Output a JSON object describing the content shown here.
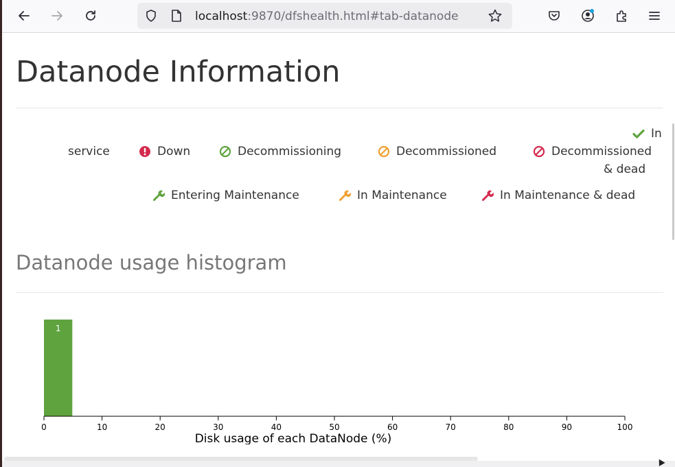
{
  "browser": {
    "url_host": "localhost",
    "url_rest": ":9870/dfshealth.html#tab-datanode"
  },
  "page": {
    "title": "Datanode Information",
    "histogram_title": "Datanode usage histogram"
  },
  "legend": {
    "in_service_1": "In",
    "in_service_2": "service",
    "down": "Down",
    "decommissioning": "Decommissioning",
    "decommissioned": "Decommissioned",
    "decommissioned_dead_1": "Decommissioned",
    "decommissioned_dead_2": "& dead",
    "entering_maintenance": "Entering Maintenance",
    "in_maintenance": "In Maintenance",
    "in_maintenance_dead": "In Maintenance & dead"
  },
  "colors": {
    "green": "#5fa33e",
    "red": "#d42a4e",
    "orange": "#f0a030",
    "bar": "#5fa33e"
  },
  "chart_data": {
    "type": "bar",
    "xlabel": "Disk usage of each DataNode (%)",
    "xlim": [
      0,
      100
    ],
    "x_ticks": [
      "0",
      "10",
      "20",
      "30",
      "40",
      "50",
      "60",
      "70",
      "80",
      "90",
      "100"
    ],
    "bins": [
      {
        "from": 0,
        "to": 5,
        "value": 1,
        "label": "1"
      }
    ]
  }
}
